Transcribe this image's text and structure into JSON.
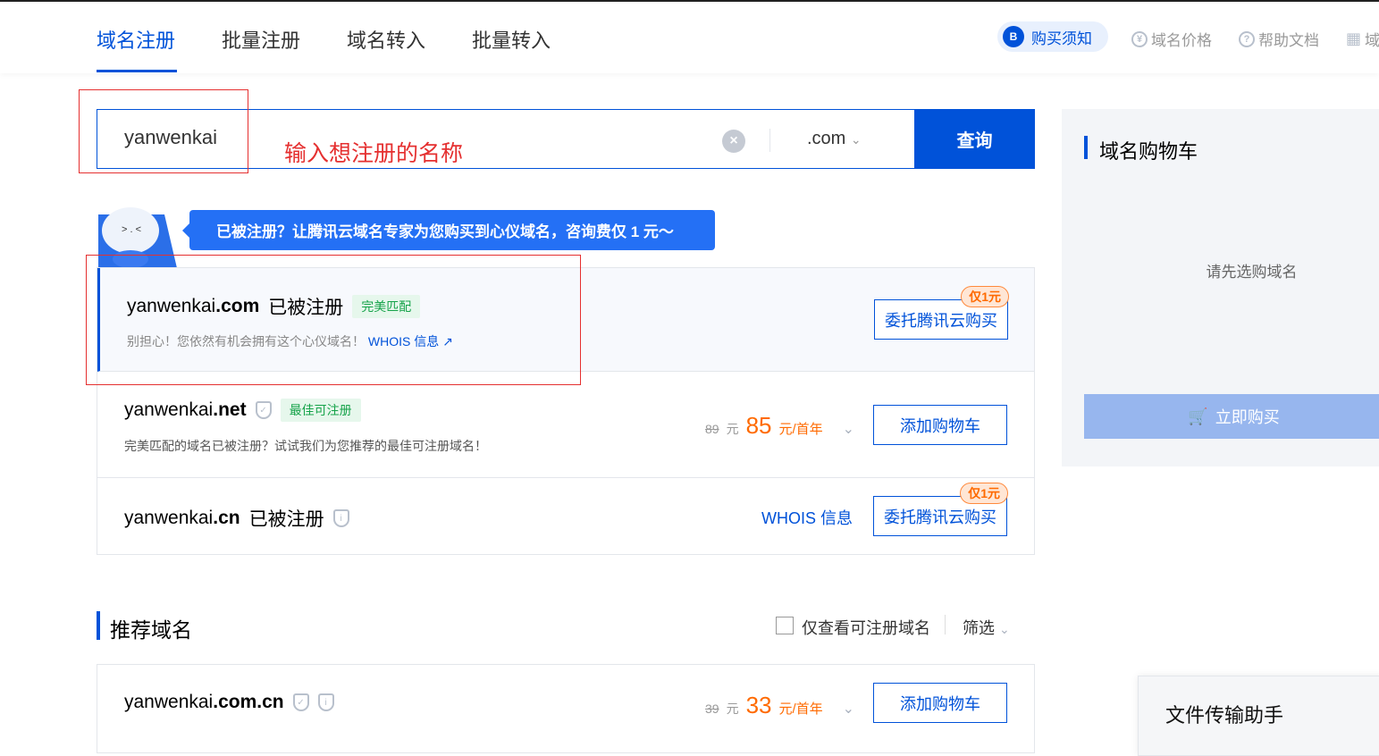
{
  "nav": {
    "tabs": [
      "域名注册",
      "批量注册",
      "域名转入",
      "批量转入"
    ],
    "notice": "购买须知",
    "links": [
      "域名价格",
      "帮助文档",
      "域"
    ]
  },
  "search": {
    "value": "yanwenkai",
    "suffix": ".com",
    "button": "查询",
    "annotation": "输入想注册的名称"
  },
  "cart": {
    "title": "域名购物车",
    "empty": "请先选购域名",
    "buy": "立即购买"
  },
  "banner": "已被注册？让腾讯云域名专家为您购买到心仪域名，咨询费仅 1 元～",
  "results": [
    {
      "name": "yanwenkai",
      "tld": ".com",
      "status": "已被注册",
      "tag": "完美匹配",
      "sub": "别担心！您依然有机会拥有这个心仪域名！",
      "whois": "WHOIS 信息",
      "button": "委托腾讯云购买",
      "badge": "仅1元"
    },
    {
      "name": "yanwenkai",
      "tld": ".net",
      "tag": "最佳可注册",
      "sub": "完美匹配的域名已被注册？试试我们为您推荐的最佳可注册域名！",
      "old_price": "89",
      "old_unit": "元",
      "price": "85",
      "unit": "元/首年",
      "button": "添加购物车"
    },
    {
      "name": "yanwenkai",
      "tld": ".cn",
      "status": "已被注册",
      "whois": "WHOIS 信息",
      "button": "委托腾讯云购买",
      "badge": "仅1元"
    }
  ],
  "recommended": {
    "title": "推荐域名",
    "checkbox": "仅查看可注册域名",
    "filter": "筛选",
    "rows": [
      {
        "name": "yanwenkai",
        "tld": ".com.cn",
        "old_price": "39",
        "old_unit": "元",
        "price": "33",
        "unit": "元/首年",
        "button": "添加购物车"
      }
    ]
  },
  "float": "文件传输助手"
}
